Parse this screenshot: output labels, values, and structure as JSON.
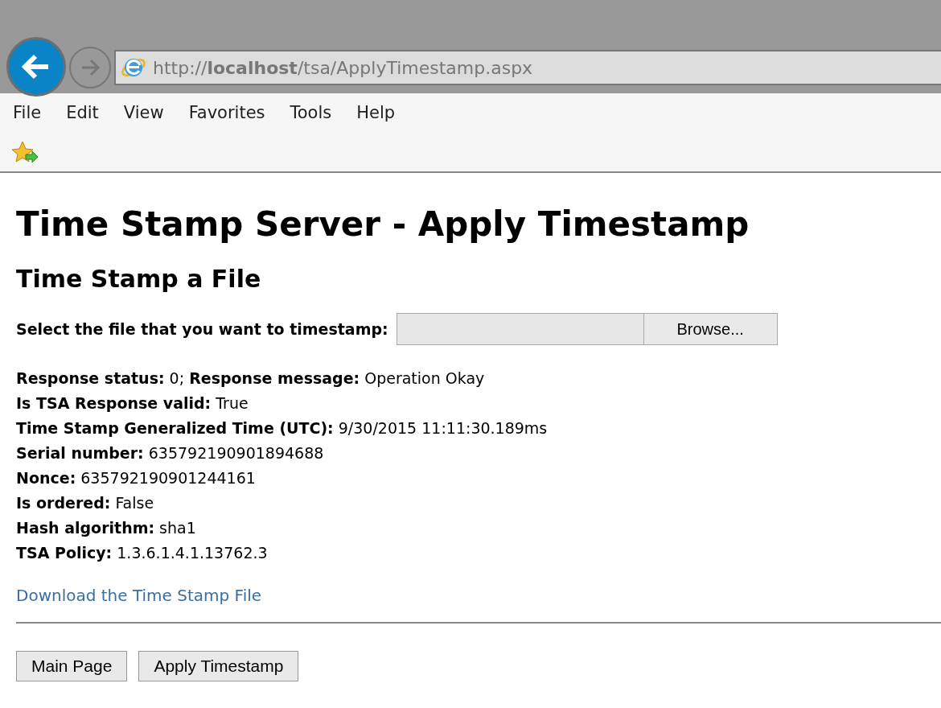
{
  "browser": {
    "address": "http://**localhost**/tsa/ApplyTimestamp.aspx",
    "menu": [
      "File",
      "Edit",
      "View",
      "Favorites",
      "Tools",
      "Help"
    ]
  },
  "page": {
    "title": "Time Stamp Server - Apply Timestamp",
    "subtitle": "Time Stamp a File",
    "file_label": "Select the file that you want to timestamp:",
    "browse_button": "Browse...",
    "details": [
      "**Response status:** 0; **Response message:** Operation Okay",
      "**Is TSA Response valid:** True",
      "**Time Stamp Generalized Time (UTC):** 9/30/2015 11:11:30.189ms",
      "**Serial number:** 635792190901894688",
      "**Nonce:** 635792190901244161",
      "**Is ordered:** False",
      "**Hash algorithm:** sha1",
      "**TSA Policy:** 1.3.6.1.4.1.13762.3"
    ],
    "download_link": "Download the Time Stamp File",
    "buttons": [
      "Main Page",
      "Apply Timestamp"
    ]
  }
}
